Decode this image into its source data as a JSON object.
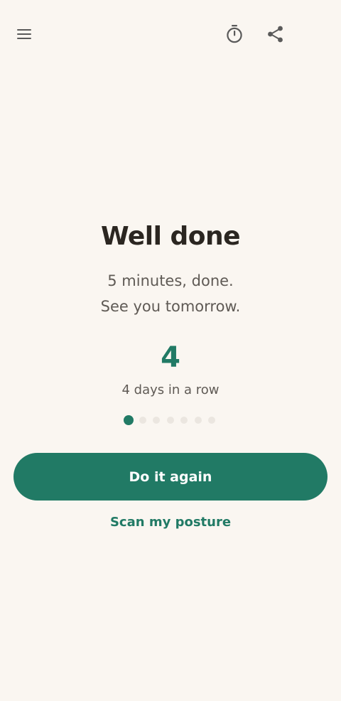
{
  "header": {
    "menu_icon": "hamburger-menu-icon",
    "timer_icon": "stopwatch-icon",
    "share_icon": "share-icon"
  },
  "completion": {
    "title": "Well done",
    "line1": "5 minutes, done.",
    "line2": "See you tomorrow."
  },
  "streak": {
    "count": "4",
    "label": "4 days in a row",
    "progress_total_dots": 7,
    "progress_active_index": 0
  },
  "actions": {
    "primary_label": "Do it again",
    "secondary_label": "Scan my posture"
  },
  "colors": {
    "background": "#faf6f1",
    "accent": "#217a65",
    "text_dark": "#2b2621",
    "text_muted": "#5f5a55",
    "icon": "#5a5a5a",
    "dot_inactive": "#ebe6e0"
  }
}
